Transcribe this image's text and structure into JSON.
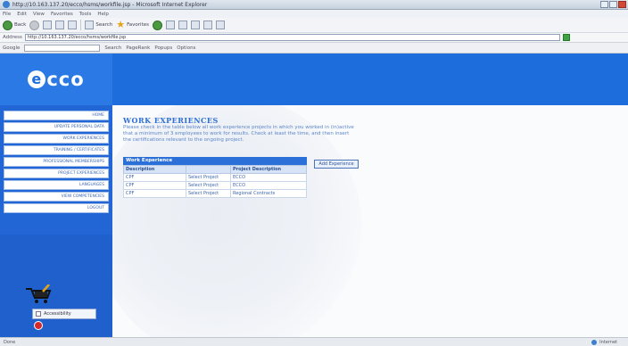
{
  "window": {
    "title": "http://10.163.137.20/ecco/hsms/workfile.jsp - Microsoft Internet Explorer"
  },
  "menu": [
    "File",
    "Edit",
    "View",
    "Favorites",
    "Tools",
    "Help"
  ],
  "toolbar": {
    "back_label": "Back",
    "search_label": "Search",
    "favorites_label": "Favorites"
  },
  "address": {
    "label": "Address",
    "value": "http://10.163.137.20/ecco/hsms/workfile.jsp"
  },
  "googlebar": {
    "label": "Google",
    "search_label": "Search",
    "pagerank_label": "PageRank",
    "popups_label": "Popups",
    "options_label": "Options"
  },
  "brand": {
    "logo_letter": "e",
    "logo_text": "cco"
  },
  "sidebar": {
    "items": [
      {
        "label": "HOME"
      },
      {
        "label": "UPDATE PERSONAL DATA"
      },
      {
        "label": "WORK EXPERIENCES"
      },
      {
        "label": "TRAINING / CERTIFICATES"
      },
      {
        "label": "PROFESSIONAL MEMBERSHIPS"
      },
      {
        "label": "PROJECT EXPERIENCES"
      },
      {
        "label": "LANGUAGES"
      },
      {
        "label": "VIEW COMPETENCIES"
      },
      {
        "label": "LOGOUT"
      }
    ],
    "account_label": "Accessibility"
  },
  "main": {
    "heading": "WORK EXPERIENCES",
    "intro": "Please check in the table below all work experience projects in which you worked in (in)active that a minimum of 3 employees to work for results. Check at least the time, and then insert the certifications relevant to the ongoing project.",
    "table": {
      "title": "Work Experience",
      "columns": [
        "Description",
        "",
        "Project Description"
      ],
      "rows": [
        {
          "desc": "CPF",
          "action": "Select Project",
          "project": "ECCO"
        },
        {
          "desc": "CPF",
          "action": "Select Project",
          "project": "ECCO"
        },
        {
          "desc": "CPF",
          "action": "Select Project",
          "project": "Regional Contracts"
        }
      ]
    },
    "add_button": "Add Experience"
  },
  "status": {
    "left": "Done",
    "right": "Internet"
  },
  "colors": {
    "brand_blue": "#1e6ddc",
    "sidebar_blue": "#2266d6",
    "heading_blue": "#2d6fd3"
  }
}
